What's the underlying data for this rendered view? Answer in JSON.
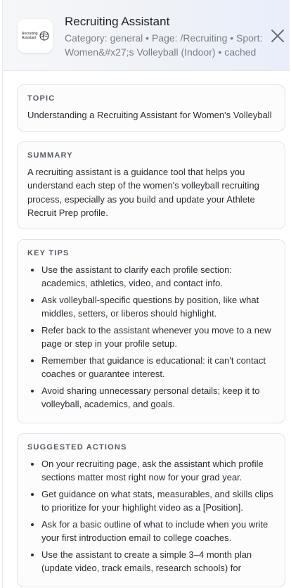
{
  "header": {
    "title": "Recruiting Assistant",
    "meta": "Category: general • Page: /Recruiting • Sport: Women&#x27;s Volleyball (Indoor) • cached",
    "logo_text": "Recruiting Assistant",
    "close_icon": "close-icon"
  },
  "sections": {
    "topic": {
      "label": "TOPIC",
      "text": "Understanding a Recruiting Assistant for Women's Volleyball"
    },
    "summary": {
      "label": "SUMMARY",
      "text": "A recruiting assistant is a guidance tool that helps you understand each step of the women's volleyball recruiting process, especially as you build and update your Athlete Recruit Prep profile."
    },
    "key_tips": {
      "label": "KEY TIPS",
      "items": [
        "Use the assistant to clarify each profile section: academics, athletics, video, and contact info.",
        "Ask volleyball-specific questions by position, like what middles, setters, or liberos should highlight.",
        "Refer back to the assistant whenever you move to a new page or step in your profile setup.",
        "Remember that guidance is educational: it can't contact coaches or guarantee interest.",
        "Avoid sharing unnecessary personal details; keep it to volleyball, academics, and goals."
      ]
    },
    "suggested_actions": {
      "label": "SUGGESTED ACTIONS",
      "items": [
        "On your recruiting page, ask the assistant which profile sections matter most right now for your grad year.",
        "Get guidance on what stats, measurables, and skills clips to prioritize for your highlight video as a [Position].",
        "Ask for a basic outline of what to include when you write your first introduction email to college coaches.",
        "Use the assistant to create a simple 3–4 month plan (update video, track emails, research schools) for"
      ]
    }
  }
}
